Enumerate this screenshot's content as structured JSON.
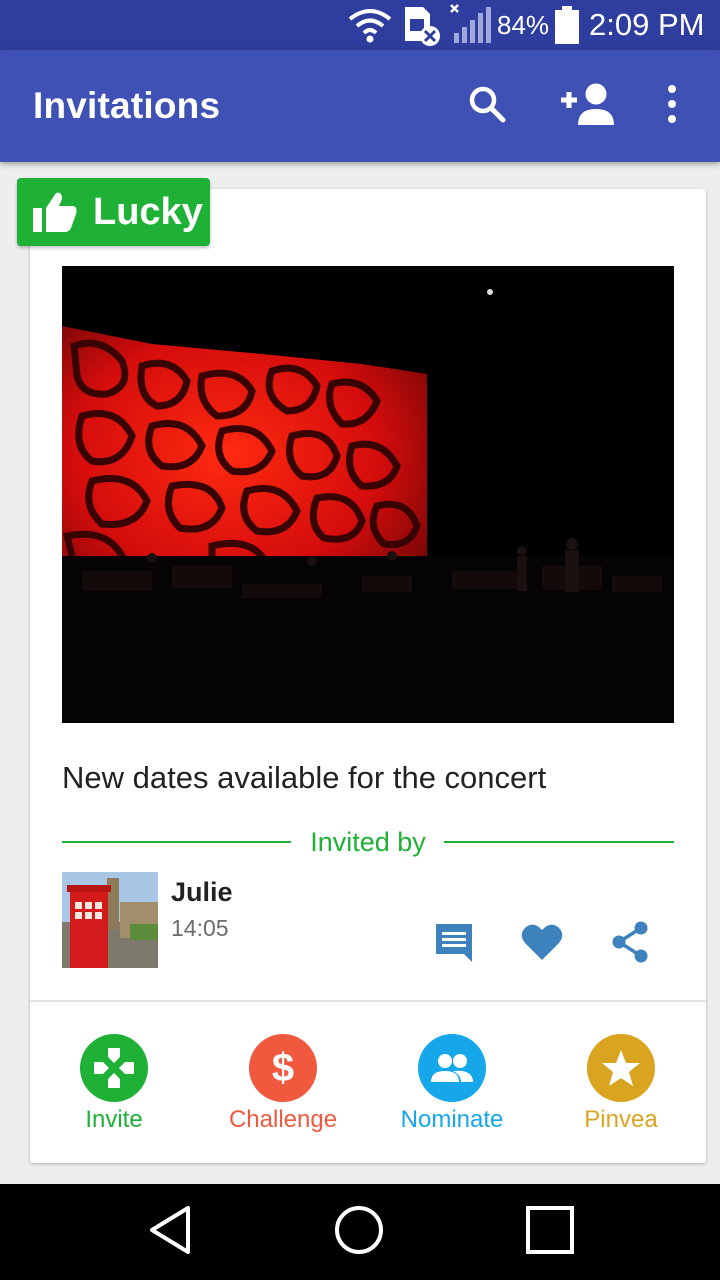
{
  "status_bar": {
    "battery": "84%",
    "time": "2:09 PM"
  },
  "app_bar": {
    "title": "Invitations"
  },
  "post": {
    "badge_label": "Lucky",
    "title": "New dates available for the concert",
    "invited_by_label": "Invited by",
    "user_name": "Julie",
    "time": "14:05"
  },
  "actions": [
    {
      "label": "Invite",
      "color": "#1fb136",
      "icon": "gamepad-icon"
    },
    {
      "label": "Challenge",
      "color": "#f0593e",
      "icon": "dollar-icon"
    },
    {
      "label": "Nominate",
      "color": "#16a6ea",
      "icon": "people-icon"
    },
    {
      "label": "Pinvea",
      "color": "#d9a520",
      "icon": "star-icon"
    }
  ],
  "colors": {
    "status_bar": "#2f3e9e",
    "app_bar": "#3f51b5",
    "accent_green": "#1fb136",
    "icon_blue": "#3d82bd"
  }
}
